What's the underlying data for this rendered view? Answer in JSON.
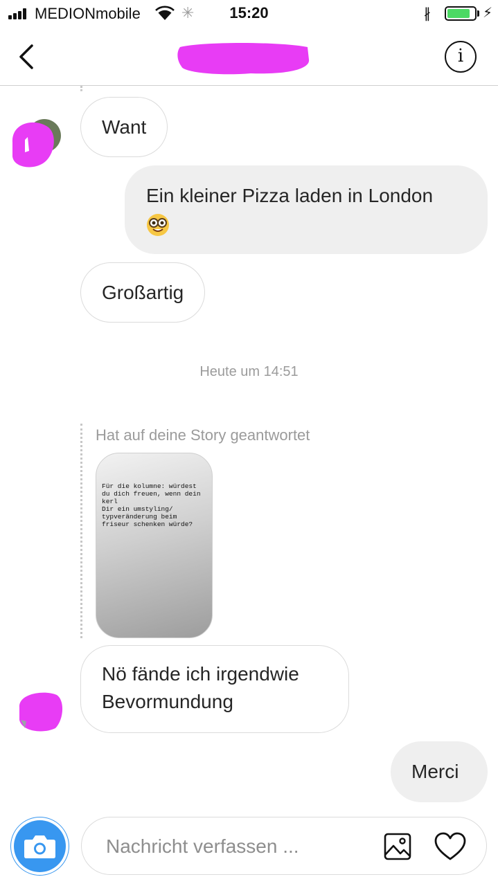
{
  "status_bar": {
    "carrier": "MEDIONmobile",
    "time": "15:20",
    "battery_level": 0.85,
    "icons": [
      "signal-icon",
      "wifi-icon",
      "activity-icon",
      "bluetooth-icon",
      "battery-icon",
      "charging-icon"
    ]
  },
  "header": {
    "back_icon": "chevron-left-icon",
    "info_icon": "info-icon",
    "info_glyph": "i",
    "title_redaction_color": "#e83cf5"
  },
  "messages": [
    {
      "direction": "incoming",
      "text": "Want"
    },
    {
      "direction": "outgoing",
      "text": "Ein kleiner Pizza laden in London",
      "emoji": "nerd-face-emoji"
    },
    {
      "direction": "incoming",
      "text": "Großartig"
    }
  ],
  "timestamp": "Heute um 14:51",
  "story_reply": {
    "label": "Hat auf deine Story geantwortet",
    "story_text": "Für die kolumne: würdest\ndu dich freuen, wenn dein\nkerl\nDir ein umstyling/\ntypveränderung beim\nfriseur schenken würde?"
  },
  "messages_after": [
    {
      "direction": "incoming",
      "text": "Nö fände ich irgendwie Bevormundung"
    },
    {
      "direction": "outgoing",
      "text": "Merci"
    }
  ],
  "composer": {
    "placeholder": "Nachricht verfassen ...",
    "camera_icon": "camera-icon",
    "gallery_icon": "image-icon",
    "heart_icon": "heart-icon"
  },
  "colors": {
    "accent": "#3897f0",
    "redaction": "#e83cf5",
    "incoming_border": "#dbdbdb",
    "outgoing_bg": "#efefef",
    "battery": "#4cd964"
  }
}
